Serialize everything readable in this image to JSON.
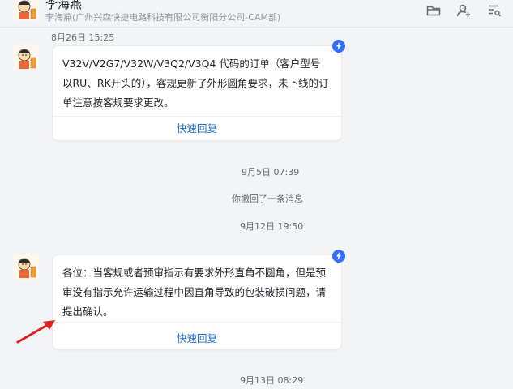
{
  "header": {
    "contact_name": "李海燕",
    "contact_org": "李海燕(广州兴森快捷电路科技有限公司衡阳分公司-CAM部)",
    "icons": [
      "folder-icon",
      "add-user-icon",
      "settings-list-icon"
    ]
  },
  "messages": [
    {
      "timestamp": "8月26日 15:25",
      "text": "V32V/V2G7/V32W/V3Q2/V3Q4 代码的订单（客户型号以RU、RK开头的），客规更新了外形圆角要求，未下线的订单注意按客规要求更改。",
      "button": "快速回复"
    },
    {
      "timestamp": "9月12日 19:50",
      "text": "各位：当客规或者预审指示有要求外形直角不圆角，但是预审没有指示允许运输过程中因直角导致的包装破损问题，请提出确认。",
      "button": "快速回复"
    }
  ],
  "system": {
    "ts_sep5": "9月5日 07:39",
    "recalled": "你撤回了一条消息",
    "ts_sep13": "9月13日 08:29"
  },
  "colors": {
    "accent": "#3370ff",
    "link": "#1f6fd1",
    "arrow": "#e02020",
    "background": "#f3f4f6"
  }
}
